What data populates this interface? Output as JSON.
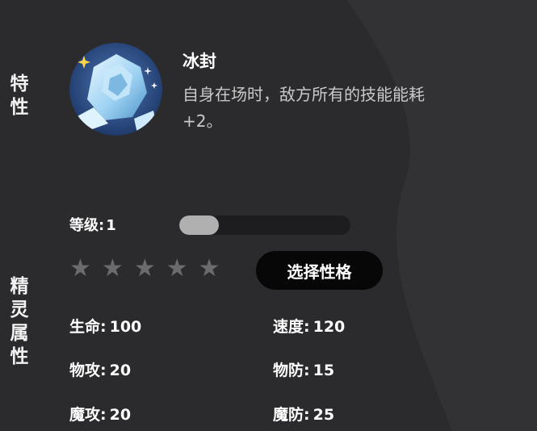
{
  "labels": {
    "trait": [
      "特",
      "性"
    ],
    "attributes": [
      "精",
      "灵",
      "属",
      "性"
    ]
  },
  "trait": {
    "icon": "ice-crystal-icon",
    "name": "冰封",
    "description_line1": "自身在场时，敌方所有的技能能耗",
    "description_line2": "+2。"
  },
  "level": {
    "label": "等级:",
    "value": "1",
    "progress": 0.23
  },
  "stars": {
    "total": 5,
    "filled": 0
  },
  "buttons": {
    "choose_personality": "选择性格"
  },
  "stats": {
    "hp": {
      "label": "生命:",
      "value": "100"
    },
    "speed": {
      "label": "速度:",
      "value": "120"
    },
    "physical_attack": {
      "label": "物攻:",
      "value": "20"
    },
    "physical_defense": {
      "label": "物防:",
      "value": "15"
    },
    "magic_attack": {
      "label": "魔攻:",
      "value": "20"
    },
    "magic_defense": {
      "label": "魔防:",
      "value": "25"
    }
  },
  "colors": {
    "background": "#2b2b2d",
    "button": "#070708",
    "bar_fill": "#b0b0b0",
    "star_empty": "#6b6b6e"
  }
}
